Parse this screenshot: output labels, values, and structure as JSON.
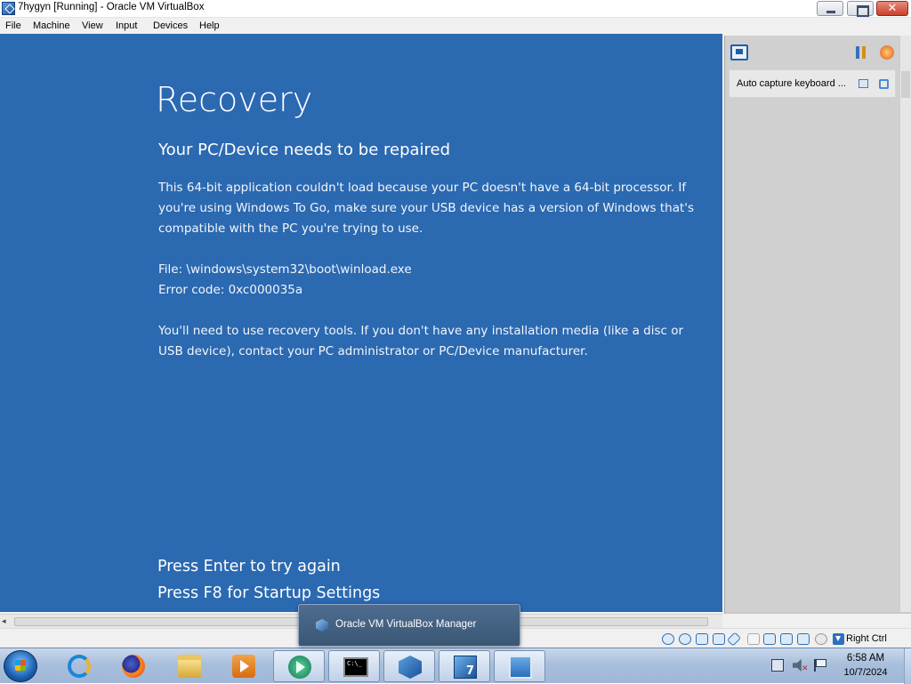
{
  "window": {
    "title": "7hygyn [Running] - Oracle VM VirtualBox",
    "close_glyph": "✕"
  },
  "menu": [
    "File",
    "Machine",
    "View",
    "Input",
    "Devices",
    "Help"
  ],
  "guest_screen": {
    "background": "#2b69b1",
    "title": "Recovery",
    "subtitle": "Your PC/Device needs to be repaired",
    "paragraph1": "This 64-bit application couldn't load because your PC doesn't have a 64-bit processor. If you're using Windows To Go, make sure your USB device has a version of Windows that's compatible with the PC you're trying to use.",
    "file_line": "File: \\windows\\system32\\boot\\winload.exe",
    "error_line": "Error code: 0xc000035a",
    "paragraph2": "You'll need to use recovery tools. If you don't have any installation media (like a disc or USB device), contact your PC administrator or PC/Device manufacturer.",
    "press_enter": "Press Enter to try again",
    "press_f8": "Press F8 for Startup Settings"
  },
  "side_panel": {
    "notification_text": "Auto capture keyboard ...",
    "icons": [
      "notification-center-icon",
      "sort-icon",
      "close-all-icon"
    ]
  },
  "status_bar": {
    "host_key": "Right Ctrl",
    "icons": [
      "hard-disk-icon",
      "optical-drive-icon",
      "audio-icon",
      "network-icon",
      "usb-icon",
      "shared-folder-icon",
      "display-icon",
      "recording-icon",
      "mouse-integration-icon",
      "cpu-icon"
    ]
  },
  "scrollbar": {
    "left_arrow": "◂"
  },
  "taskbar": {
    "items": [
      {
        "name": "internet-explorer",
        "active": false
      },
      {
        "name": "firefox",
        "active": false
      },
      {
        "name": "file-explorer",
        "active": false
      },
      {
        "name": "media-center",
        "active": false
      },
      {
        "name": "media-player",
        "active": false
      },
      {
        "name": "command-prompt",
        "active": false
      },
      {
        "name": "virtualbox",
        "active": true
      },
      {
        "name": "virtualbox-7",
        "active": false
      },
      {
        "name": "remote-desktop",
        "active": false
      }
    ],
    "cmd_glyph_text": "C:\\_",
    "vbox7_glyph_text": "7",
    "tooltip": "Oracle VM VirtualBox Manager",
    "clock_time": "6:58 AM",
    "clock_date": "10/7/2024",
    "volume_mute_glyph": "✕"
  }
}
